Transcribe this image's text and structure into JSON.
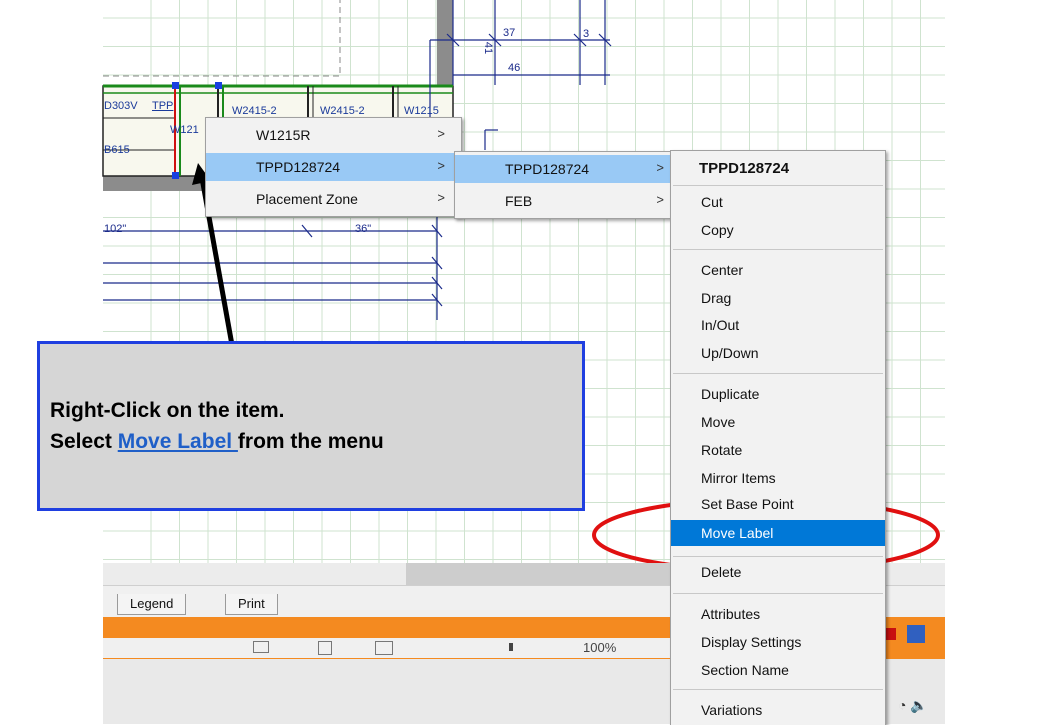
{
  "drawing": {
    "cabinet_labels": [
      "D303V",
      "TPP",
      "W2415-2",
      "W2415-2",
      "W1215",
      "W121",
      "B615"
    ],
    "dimensions": [
      "37",
      "3",
      "46",
      "41",
      "102\"",
      "36\""
    ]
  },
  "tabs": [
    "Legend",
    "Print"
  ],
  "status": {
    "zoom": "100%"
  },
  "menu1": {
    "items": [
      {
        "label": "W1215R",
        "has_submenu": true
      },
      {
        "label": "TPPD128724",
        "has_submenu": true,
        "highlighted": true
      },
      {
        "label": "Placement Zone",
        "has_submenu": true
      }
    ],
    "arrow": ">"
  },
  "menu2": {
    "items": [
      {
        "label": "TPPD128724",
        "has_submenu": true,
        "highlighted": true
      },
      {
        "label": "FEB",
        "has_submenu": true
      }
    ]
  },
  "menu3": {
    "title": "TPPD128724",
    "groups": [
      [
        "Cut",
        "Copy"
      ],
      [
        "Center",
        "Drag",
        "In/Out",
        "Up/Down"
      ],
      [
        "Duplicate",
        "Move",
        "Rotate",
        "Mirror Items",
        "Set Base Point",
        "Move Label"
      ],
      [
        "Delete"
      ],
      [
        "Attributes",
        "Display Settings",
        "Section Name"
      ],
      [
        "Variations"
      ]
    ],
    "selected": "Move Label"
  },
  "callout": {
    "line1": "Right-Click on the item.",
    "line2_before": "Select ",
    "line2_link": "Move Label ",
    "line2_after": "from the menu"
  },
  "colors": {
    "callout_border": "#1f3fe0",
    "highlight_oval": "#e01010",
    "menu_selected": "#0078d7",
    "menu_hover": "#99c9f5",
    "app_bar": "#f48a20"
  },
  "icons": [
    "wifi-icon",
    "volume-icon"
  ]
}
